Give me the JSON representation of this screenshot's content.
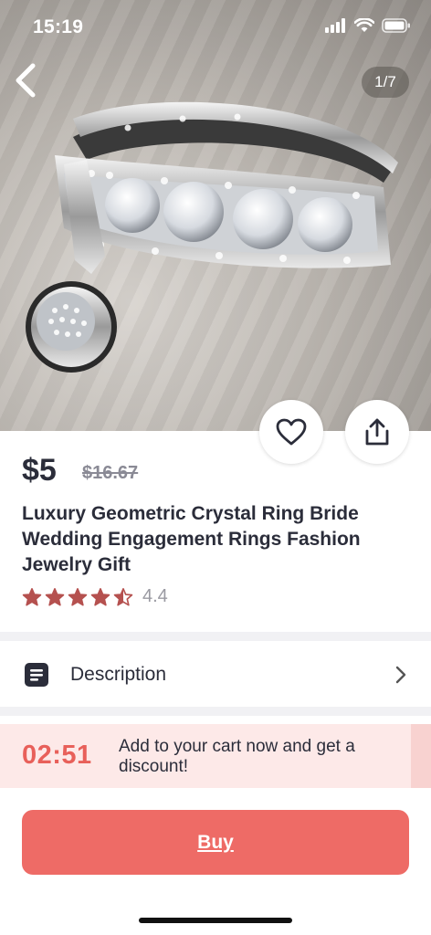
{
  "status_bar": {
    "time": "15:19"
  },
  "gallery": {
    "counter": "1/7"
  },
  "product": {
    "price": "$5",
    "original_price": "$16.67",
    "title": "Luxury Geometric Crystal Ring Bride Wedding Engagement Rings Fashion Jewelry Gift",
    "rating": 4.4,
    "rating_label": "4.4"
  },
  "description": {
    "label": "Description"
  },
  "promo": {
    "timer": "02:51",
    "message": "Add to your cart now and get a discount!"
  },
  "actions": {
    "buy_label": "Buy"
  },
  "colors": {
    "accent": "#ee6b66",
    "star": "#b5514f",
    "promo_bg": "#fde9e8"
  },
  "icons": [
    "back-chevron-icon",
    "heart-icon",
    "share-icon",
    "document-icon",
    "chevron-right-icon",
    "star-icon"
  ]
}
